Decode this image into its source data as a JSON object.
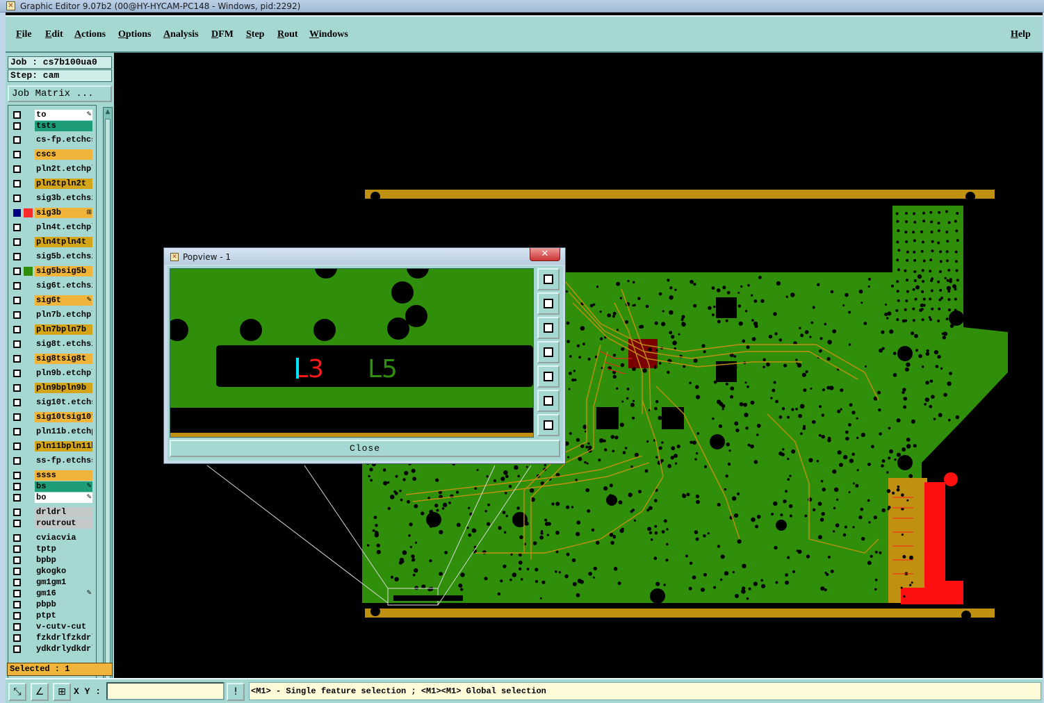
{
  "window": {
    "title": "Graphic Editor 9.07b2 (00@HY-HYCAM-PC148 - Windows, pid:2292)"
  },
  "menu": {
    "items": [
      "File",
      "Edit",
      "Actions",
      "Options",
      "Analysis",
      "DFM",
      "Step",
      "Rout",
      "Windows"
    ],
    "help": "Help"
  },
  "job": {
    "label": "Job : cs7b100ua0",
    "step": "Step: cam",
    "matrix_button": "Job Matrix ..."
  },
  "layers": [
    {
      "name": "to",
      "color": "#ffffff",
      "mark": "✎"
    },
    {
      "name": "ts",
      "color": "#1f9c78",
      "mark": ""
    },
    {
      "name": "cs-fp.etch",
      "color": "#a5d8d2",
      "mark": ""
    },
    {
      "name": "cs",
      "color": "#f0b43a",
      "mark": ""
    },
    {
      "name": "pln2t.etch",
      "color": "#a5d8d2",
      "mark": ""
    },
    {
      "name": "pln2t",
      "color": "#d4a419",
      "mark": ""
    },
    {
      "name": "sig3b.etch",
      "color": "#a5d8d2",
      "mark": ""
    },
    {
      "name": "sig3b",
      "color": "#f0b43a",
      "mark": "⊞"
    },
    {
      "name": "pln4t.etch",
      "color": "#a5d8d2",
      "mark": ""
    },
    {
      "name": "pln4t",
      "color": "#d4a419",
      "mark": ""
    },
    {
      "name": "sig5b.etch",
      "color": "#a5d8d2",
      "mark": ""
    },
    {
      "name": "sig5b",
      "color": "#f0b43a",
      "mark": ""
    },
    {
      "name": "sig6t.etch",
      "color": "#a5d8d2",
      "mark": ""
    },
    {
      "name": "sig6t",
      "color": "#f0b43a",
      "mark": "✎"
    },
    {
      "name": "pln7b.etch",
      "color": "#a5d8d2",
      "mark": ""
    },
    {
      "name": "pln7b",
      "color": "#d4a419",
      "mark": ""
    },
    {
      "name": "sig8t.etch",
      "color": "#a5d8d2",
      "mark": ""
    },
    {
      "name": "sig8t",
      "color": "#f0b43a",
      "mark": ""
    },
    {
      "name": "pln9b.etch",
      "color": "#a5d8d2",
      "mark": ""
    },
    {
      "name": "pln9b",
      "color": "#d4a419",
      "mark": ""
    },
    {
      "name": "sig10t.etch",
      "color": "#a5d8d2",
      "mark": ""
    },
    {
      "name": "sig10t",
      "color": "#f0b43a",
      "mark": ""
    },
    {
      "name": "pln11b.etch",
      "color": "#a5d8d2",
      "mark": ""
    },
    {
      "name": "pln11b",
      "color": "#d4a419",
      "mark": ""
    },
    {
      "name": "ss-fp.etch",
      "color": "#a5d8d2",
      "mark": ""
    },
    {
      "name": "ss",
      "color": "#f0b43a",
      "mark": ""
    },
    {
      "name": "bs",
      "color": "#1f9c78",
      "mark": "✎"
    },
    {
      "name": "bo",
      "color": "#ffffff",
      "mark": "✎"
    },
    {
      "name": "drl",
      "color": "#c4c8c8",
      "mark": ""
    },
    {
      "name": "rout",
      "color": "#c4c8c8",
      "mark": ""
    },
    {
      "name": "cvia",
      "color": "#a5d8d2",
      "mark": ""
    },
    {
      "name": "tp",
      "color": "#a5d8d2",
      "mark": ""
    },
    {
      "name": "bp",
      "color": "#a5d8d2",
      "mark": ""
    },
    {
      "name": "gko",
      "color": "#a5d8d2",
      "mark": ""
    },
    {
      "name": "gm1",
      "color": "#a5d8d2",
      "mark": ""
    },
    {
      "name": "gm16",
      "color": "#a5d8d2",
      "mark": "✎"
    },
    {
      "name": "pb",
      "color": "#a5d8d2",
      "mark": ""
    },
    {
      "name": "pt",
      "color": "#a5d8d2",
      "mark": ""
    },
    {
      "name": "v-cut",
      "color": "#a5d8d2",
      "mark": ""
    },
    {
      "name": "fzkdrl",
      "color": "#a5d8d2",
      "mark": ""
    },
    {
      "name": "ydkdrl",
      "color": "#a5d8d2",
      "mark": ""
    }
  ],
  "selected": "Selected : 1",
  "status": {
    "xy_label": "X Y :",
    "xy_value": "",
    "prompt": "<M1> - Single feature selection ; <M1><M1> Global selection"
  },
  "popview": {
    "title": "Popview - 1",
    "close_x": "✕",
    "label_l3": "L3",
    "label_l5": "L5",
    "close_button": "Close"
  },
  "colors": {
    "board": "#2f8f0a",
    "rail": "#c09010",
    "hot": "#ff1010",
    "ui": "#a5d8d2"
  }
}
